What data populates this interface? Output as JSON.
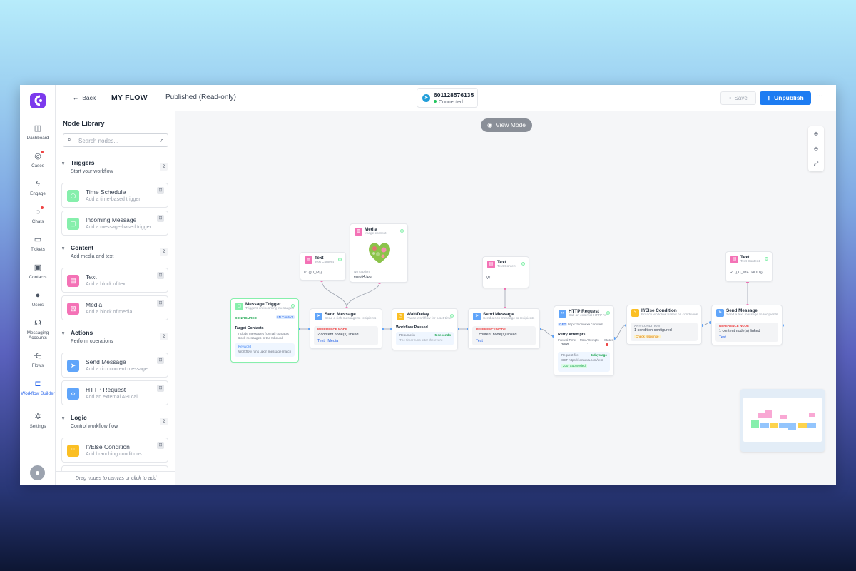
{
  "app": {
    "logo": "connexa-logo"
  },
  "rail": {
    "items": [
      {
        "label": "Dashboard",
        "icon": "layout-icon"
      },
      {
        "label": "Cases",
        "icon": "globe-icon"
      },
      {
        "label": "Engage",
        "icon": "bolt-icon"
      },
      {
        "label": "Chats",
        "icon": "chat-icon"
      },
      {
        "label": "Tickets",
        "icon": "ticket-icon"
      },
      {
        "label": "Contacts",
        "icon": "contacts-icon"
      },
      {
        "label": "Users",
        "icon": "user-icon"
      },
      {
        "label": "Messaging Accounts",
        "icon": "headset-icon"
      },
      {
        "label": "Flows",
        "icon": "flows-icon"
      },
      {
        "label": "Workflow Builder",
        "icon": "workflow-icon"
      },
      {
        "label": "Settings",
        "icon": "settings-icon"
      }
    ]
  },
  "header": {
    "back_label": "Back",
    "flow_title": "MY FLOW",
    "status": "Published (Read-only)",
    "phone_number": "601128576135",
    "connection": "Connected",
    "save_label": "Save",
    "unpublish_label": "Unpublish",
    "more_label": "···"
  },
  "library": {
    "title": "Node Library",
    "search_placeholder": "Search nodes...",
    "footer": "Drag nodes to canvas or click to add",
    "sections": [
      {
        "title": "Triggers",
        "subtitle": "Start your workflow",
        "count": "2",
        "items": [
          {
            "title": "Time Schedule",
            "desc": "Add a time-based trigger"
          },
          {
            "title": "Incoming Message",
            "desc": "Add a message-based trigger"
          }
        ]
      },
      {
        "title": "Content",
        "subtitle": "Add media and text",
        "count": "2",
        "items": [
          {
            "title": "Text",
            "desc": "Add a block of text"
          },
          {
            "title": "Media",
            "desc": "Add a block of media"
          }
        ]
      },
      {
        "title": "Actions",
        "subtitle": "Perform operations",
        "count": "2",
        "items": [
          {
            "title": "Send Message",
            "desc": "Add a rich content message"
          },
          {
            "title": "HTTP Request",
            "desc": "Add an external API call"
          }
        ]
      },
      {
        "title": "Logic",
        "subtitle": "Control workflow flow",
        "count": "2",
        "items": [
          {
            "title": "If/Else Condition",
            "desc": "Add branching conditions"
          }
        ]
      }
    ]
  },
  "canvas": {
    "view_mode": "View Mode",
    "nodes": {
      "text1": {
        "title": "Text",
        "subtitle": "Text Content",
        "body": "P: {{D_M}}"
      },
      "media": {
        "title": "Media",
        "subtitle": "Image content",
        "caption_label": "No caption",
        "filename": "emoji4.jpg"
      },
      "text2": {
        "title": "Text",
        "subtitle": "Text Content",
        "body": "W"
      },
      "text3": {
        "title": "Text",
        "subtitle": "Text Content",
        "body": "R: {{IC_METHOD}}"
      },
      "trigger": {
        "title": "Message Trigger",
        "subtitle": "Triggers on incoming messages",
        "badge": "CONFIGURED",
        "tag": "IN Contact",
        "section": "Target Contacts",
        "line1": "Include messages from all contacts",
        "line2": "Block messages in the Inbound",
        "kw_label": "Keyword",
        "kw_text": "Workflow runs upon message match"
      },
      "send1": {
        "title": "Send Message",
        "subtitle": "Send a rich message to recipients",
        "ref": "REFERENCE NODE",
        "linked": "2 content node(s) linked",
        "tag1": "Text",
        "tag2": "Media"
      },
      "wait": {
        "title": "Wait/Delay",
        "subtitle": "Pause workflow for a set time",
        "label": "Workflow Paused",
        "k": "Resume in",
        "v": "5 seconds",
        "note": "The timer runs after the event"
      },
      "send2": {
        "title": "Send Message",
        "subtitle": "Send a rich message to recipients",
        "ref": "REFERENCE NODE",
        "linked": "1 content node(s) linked",
        "tag1": "Text"
      },
      "http": {
        "title": "HTTP Request",
        "subtitle": "Call an external HTTP API",
        "method": "GET",
        "url": "https://connexa.com/test",
        "retry": "Retry Attempts",
        "c1": "Interval Time",
        "c2": "Max Attempts",
        "c3": "Status",
        "v1": "3000",
        "v2": "1",
        "rq_label": "Request fire",
        "rq_time": "4 days ago",
        "rq_url": "GET https://connexa.com/test",
        "rq_tag1": "200",
        "rq_tag2": "Succeeded"
      },
      "ifelse": {
        "title": "If/Else Condition",
        "subtitle": "Branch workflow based on conditions",
        "label": "ANY CONDITION",
        "cond": "1 condition configured",
        "tag": "Check response"
      },
      "send3": {
        "title": "Send Message",
        "subtitle": "Send a text message to recipients",
        "ref": "REFERENCE NODE",
        "linked": "1 content node(s) linked",
        "tag1": "Text"
      }
    }
  },
  "colors": {
    "accent": "#1d7cf2",
    "success": "#22c55e",
    "trigger_border": "#86efac",
    "pink": "#f472b6",
    "orange": "#fbbf24"
  }
}
